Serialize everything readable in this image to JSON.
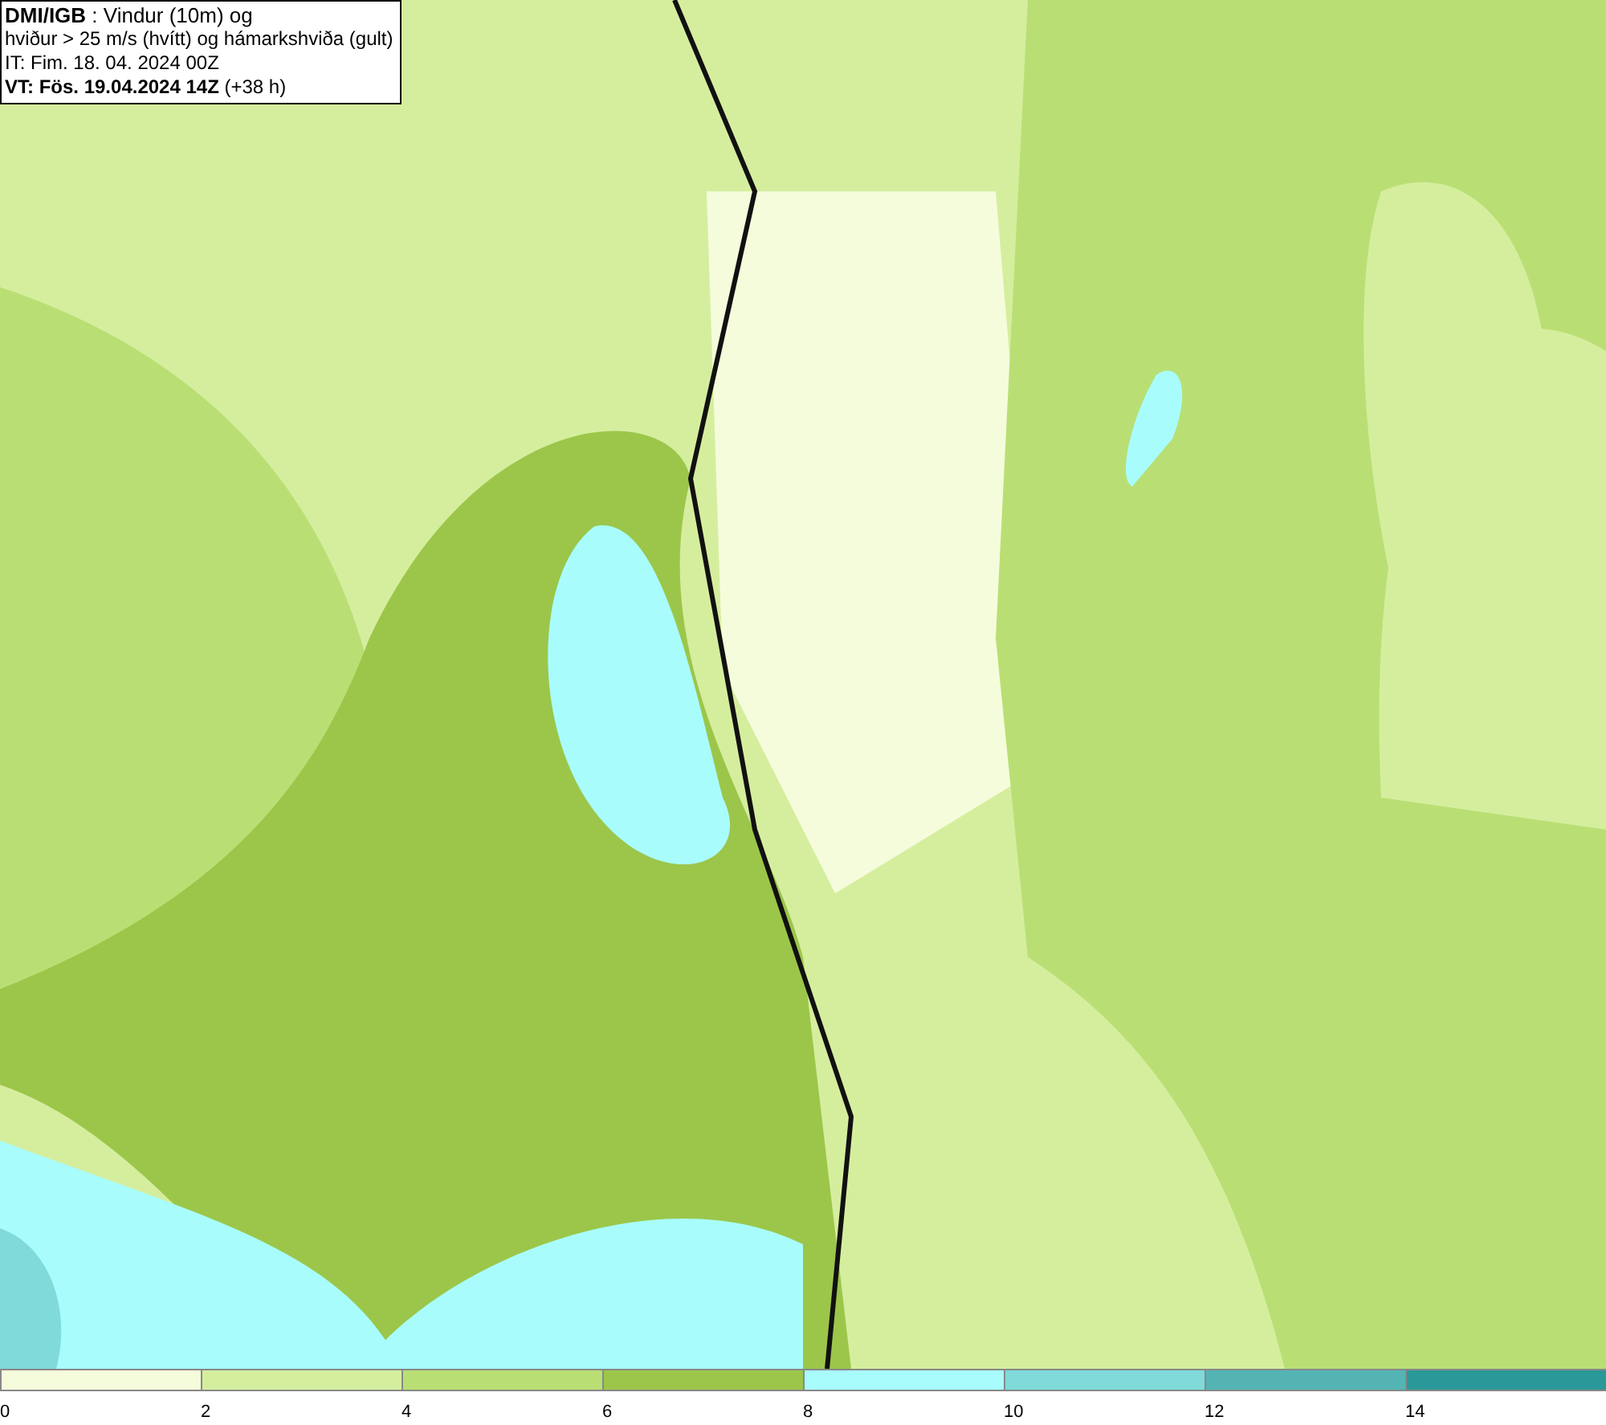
{
  "info_box": {
    "lines": [
      "**DMI/IGB** : Vindur (10m) og",
      "hviður > 25 m/s (hvítt) og hámarkshviða (gult)",
      "IT: Fim. 18. 04. 2024 00Z",
      "**VT: Fös. 19.04.2024 14Z** (+38 h)"
    ]
  },
  "legend": [
    {
      "label": "0",
      "color": "#f5fcdc"
    },
    {
      "label": "2",
      "color": "#d5ee9e"
    },
    {
      "label": "4",
      "color": "#b9df74"
    },
    {
      "label": "6",
      "color": "#9cc64a"
    },
    {
      "label": "8",
      "color": "#a8fcfc"
    },
    {
      "label": "10",
      "color": "#80dada"
    },
    {
      "label": "12",
      "color": "#54b4b4"
    },
    {
      "label": "14",
      "color": "#2a9898"
    }
  ]
}
